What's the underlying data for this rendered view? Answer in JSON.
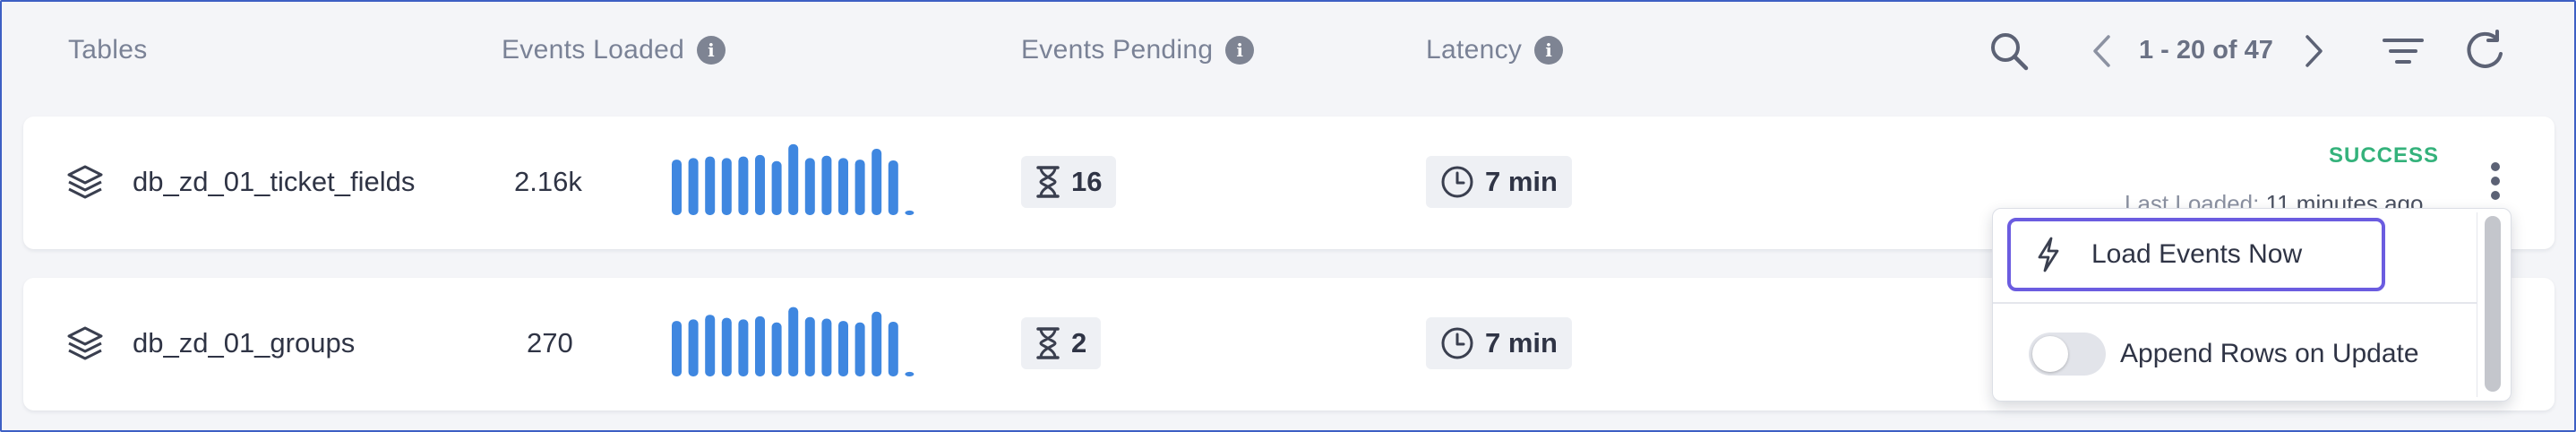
{
  "header": {
    "tables_label": "Tables",
    "events_loaded_label": "Events Loaded",
    "events_pending_label": "Events Pending",
    "latency_label": "Latency",
    "info_glyph": "i",
    "pager_text": "1 - 20 of 47"
  },
  "rows": [
    {
      "name": "db_zd_01_ticket_fields",
      "events_loaded": "2.16k",
      "sparkline": [
        0.72,
        0.74,
        0.76,
        0.74,
        0.76,
        0.78,
        0.7,
        0.92,
        0.74,
        0.77,
        0.74,
        0.72,
        0.86,
        0.71,
        0.06
      ],
      "events_pending": "16",
      "latency": "7 min",
      "status": "SUCCESS",
      "last_loaded_label": "Last Loaded:",
      "last_loaded_value": "11 minutes ago"
    },
    {
      "name": "db_zd_01_groups",
      "events_loaded": "270",
      "sparkline": [
        0.72,
        0.74,
        0.8,
        0.76,
        0.74,
        0.78,
        0.7,
        0.9,
        0.77,
        0.75,
        0.72,
        0.7,
        0.84,
        0.71,
        0.06
      ],
      "events_pending": "2",
      "latency": "7 min"
    }
  ],
  "row_menu": {
    "load_events_label": "Load Events Now",
    "append_rows_label": "Append Rows on Update",
    "append_rows_enabled": false
  },
  "colors": {
    "accent": "#3f87e0",
    "success": "#34b27b",
    "focus_outline": "#6b5ce0",
    "frame_border": "#3d5fc4"
  },
  "icons": {
    "info": "info-icon",
    "search": "search-icon",
    "prev": "chevron-left-icon",
    "next": "chevron-right-icon",
    "filter": "filter-icon",
    "refresh": "refresh-icon",
    "table": "layers-icon",
    "pending": "hourglass-icon",
    "latency": "clock-icon",
    "more": "kebab-menu-icon",
    "load": "lightning-icon"
  }
}
